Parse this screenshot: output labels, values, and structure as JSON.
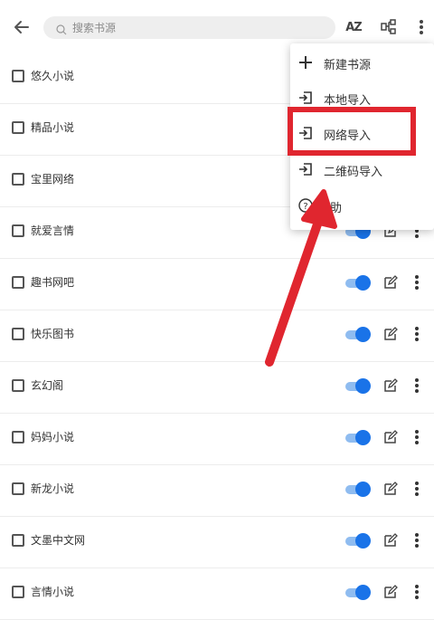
{
  "search": {
    "placeholder": "搜索书源"
  },
  "toolbar": {
    "sort_label": "AZ"
  },
  "sources": [
    {
      "name": "悠久小说",
      "enabled": true
    },
    {
      "name": "精品小说",
      "enabled": true
    },
    {
      "name": "宝里网络",
      "enabled": true
    },
    {
      "name": "就爱言情",
      "enabled": true
    },
    {
      "name": "趣书网吧",
      "enabled": true
    },
    {
      "name": "快乐图书",
      "enabled": true
    },
    {
      "name": "玄幻阁",
      "enabled": true
    },
    {
      "name": "妈妈小说",
      "enabled": true
    },
    {
      "name": "新龙小说",
      "enabled": true
    },
    {
      "name": "文墨中文网",
      "enabled": true
    },
    {
      "name": "言情小说",
      "enabled": true
    }
  ],
  "menu": {
    "items": [
      {
        "label": "新建书源",
        "icon": "plus-icon"
      },
      {
        "label": "本地导入",
        "icon": "import-icon"
      },
      {
        "label": "网络导入",
        "icon": "import-icon"
      },
      {
        "label": "二维码导入",
        "icon": "import-icon"
      },
      {
        "label": "助",
        "icon": "help-icon"
      }
    ]
  },
  "colors": {
    "accent": "#1a73e8",
    "highlight": "#e0262f",
    "arrow": "#e0262f"
  }
}
